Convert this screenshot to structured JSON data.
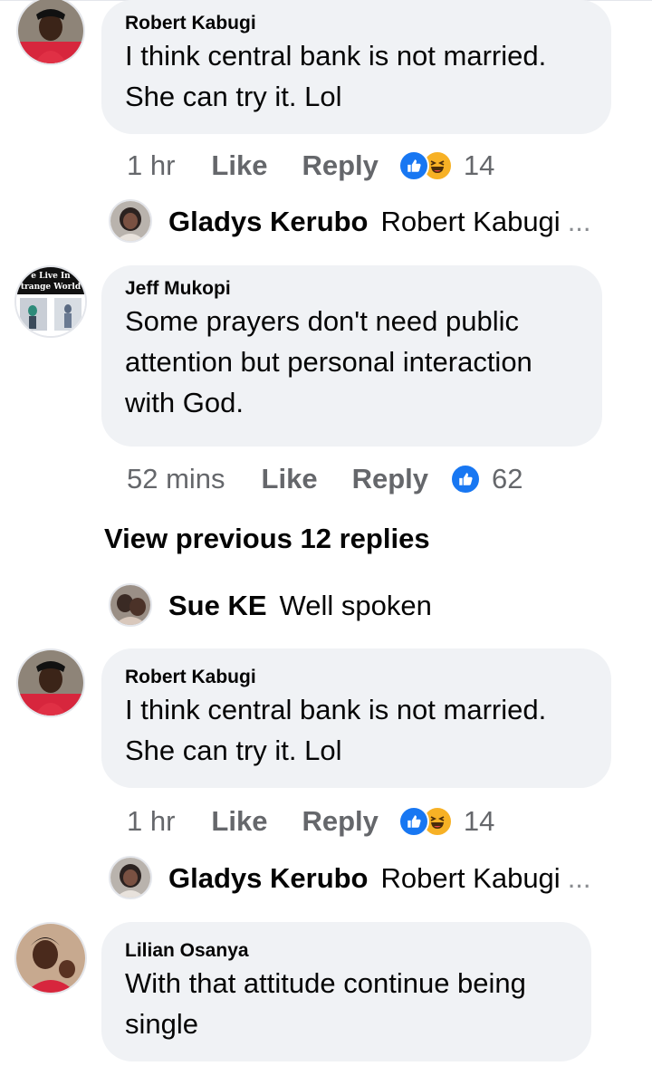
{
  "comments": [
    {
      "author": "Robert Kabugi",
      "line1": "I think central bank is not married.",
      "line2": "She can try it. Lol",
      "time": "1 hr",
      "like": "Like",
      "reply": "Reply",
      "reactions": [
        "like",
        "haha"
      ],
      "count": "14"
    },
    {
      "author": "Jeff Mukopi",
      "line1": "Some prayers don't need public",
      "line2": "attention but personal interaction",
      "line3": "with God.",
      "time": "52 mins",
      "like": "Like",
      "reply": "Reply",
      "reactions": [
        "like"
      ],
      "count": "62"
    },
    {
      "author": "Robert Kabugi",
      "line1": "I think central bank is not married.",
      "line2": "She can try it. Lol",
      "time": "1 hr",
      "like": "Like",
      "reply": "Reply",
      "reactions": [
        "like",
        "haha"
      ],
      "count": "14"
    },
    {
      "author": "Lilian Osanya",
      "line1": "With that attitude continue being",
      "line2": "single"
    }
  ],
  "replies": [
    {
      "author": "Gladys Kerubo",
      "text": "Robert Kabugi",
      "ellipsis": "..."
    },
    {
      "author": "Sue KE",
      "text": "Well spoken"
    },
    {
      "author": "Gladys Kerubo",
      "text": "Robert Kabugi",
      "ellipsis": "..."
    }
  ],
  "avatar_text": {
    "jeff_line1": "e Live In",
    "jeff_line2": "trange World"
  },
  "view_previous": "View previous 12 replies",
  "colors": {
    "bubble": "#f0f2f5",
    "meta": "#65676b",
    "like_blue": "#1877f2",
    "haha_yellow": "#f7b125"
  },
  "icons": [
    "thumbs-up-reaction-icon",
    "haha-reaction-icon"
  ]
}
